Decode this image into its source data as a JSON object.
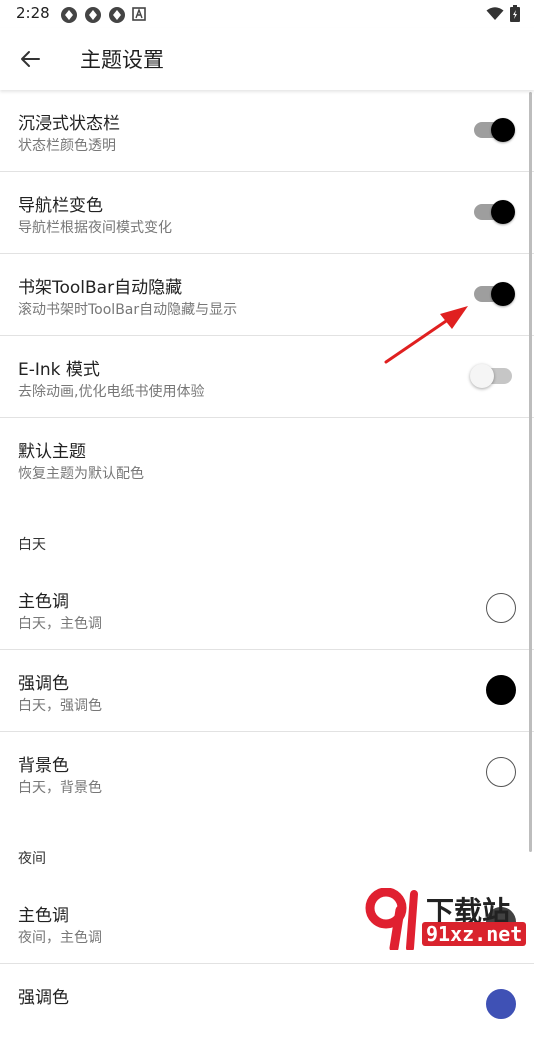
{
  "status_bar": {
    "time": "2:28"
  },
  "app_bar": {
    "title": "主题设置"
  },
  "toggles": [
    {
      "title": "沉浸式状态栏",
      "subtitle": "状态栏颜色透明",
      "on": true
    },
    {
      "title": "导航栏变色",
      "subtitle": "导航栏根据夜间模式变化",
      "on": true
    },
    {
      "title": "书架ToolBar自动隐藏",
      "subtitle": "滚动书架时ToolBar自动隐藏与显示",
      "on": true
    },
    {
      "title": "E-Ink 模式",
      "subtitle": "去除动画,优化电纸书使用体验",
      "on": false
    }
  ],
  "default_theme": {
    "title": "默认主题",
    "subtitle": "恢复主题为默认配色"
  },
  "day_section": {
    "header": "白天",
    "items": [
      {
        "title": "主色调",
        "subtitle": "白天，主色调",
        "color": "#ffffff"
      },
      {
        "title": "强调色",
        "subtitle": "白天，强调色",
        "color": "#000000"
      },
      {
        "title": "背景色",
        "subtitle": "白天，背景色",
        "color": "#ffffff"
      }
    ]
  },
  "night_section": {
    "header": "夜间",
    "items": [
      {
        "title": "主色调",
        "subtitle": "夜间，主色调",
        "color": "#424242"
      },
      {
        "title": "强调色",
        "subtitle": "",
        "color": "#3f51b5"
      }
    ]
  },
  "watermark": {
    "logo_text": "下载站",
    "domain": "91xz.net"
  },
  "colors": {
    "accent": "#000000",
    "arrow": "#e02020",
    "divider": "#e2e2e2"
  }
}
